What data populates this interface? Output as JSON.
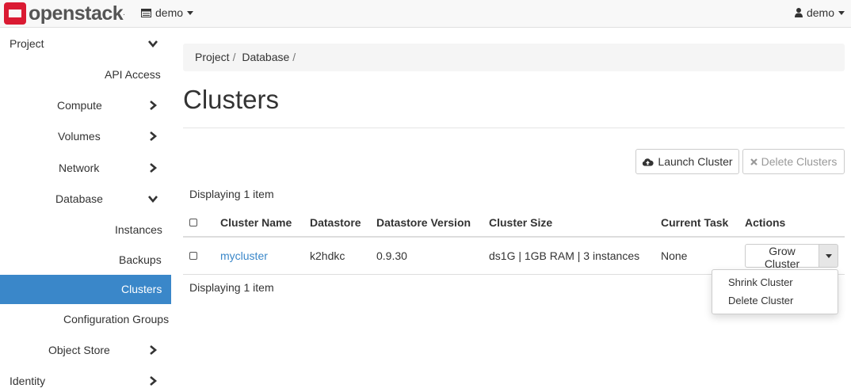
{
  "brand": {
    "name": "openstack",
    "reg": "."
  },
  "header": {
    "project": "demo",
    "user": "demo"
  },
  "sidebar": {
    "items": [
      {
        "label": "Project"
      },
      {
        "label": "API Access"
      },
      {
        "label": "Compute"
      },
      {
        "label": "Volumes"
      },
      {
        "label": "Network"
      },
      {
        "label": "Database"
      },
      {
        "label": "Instances"
      },
      {
        "label": "Backups"
      },
      {
        "label": "Clusters"
      },
      {
        "label": "Configuration Groups"
      },
      {
        "label": "Object Store"
      },
      {
        "label": "Identity"
      }
    ]
  },
  "breadcrumb": {
    "items": [
      "Project",
      "Database"
    ]
  },
  "page": {
    "title": "Clusters"
  },
  "actions": {
    "launch": "Launch Cluster",
    "delete": "Delete Clusters"
  },
  "table": {
    "display_top": "Displaying 1 item",
    "display_bottom": "Displaying 1 item",
    "headers": [
      "Cluster Name",
      "Datastore",
      "Datastore Version",
      "Cluster Size",
      "Current Task",
      "Actions"
    ],
    "rows": [
      {
        "name": "mycluster",
        "datastore": "k2hdkc",
        "version": "0.9.30",
        "size": "ds1G | 1GB RAM | 3 instances",
        "task": "None",
        "action": "Grow Cluster"
      }
    ]
  },
  "row_menu": {
    "items": [
      "Shrink Cluster",
      "Delete Cluster"
    ]
  },
  "colors": {
    "accent": "#3a87c9",
    "brand_red": "#da1a32"
  },
  "icons": [
    "openstack-logo-icon",
    "project-switcher-icon",
    "user-icon",
    "chevron-down-icon",
    "chevron-right-icon",
    "cloud-upload-icon",
    "times-icon",
    "caret-down-icon"
  ]
}
